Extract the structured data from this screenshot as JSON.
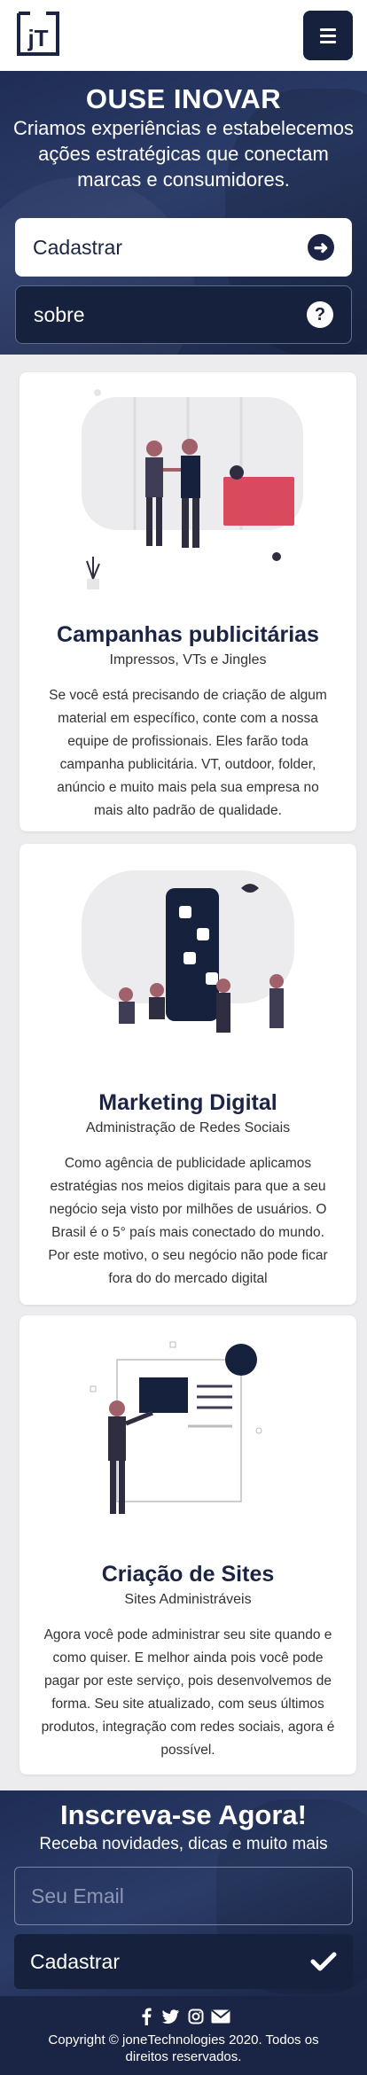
{
  "brand": {
    "logo_text": "jT"
  },
  "hero": {
    "title": "OUSE INOVAR",
    "subtitle": "Criamos experiências e estabelecemos ações estratégicas que conectam marcas e consumidores.",
    "primary_button": "Cadastrar",
    "secondary_button": "sobre"
  },
  "services": [
    {
      "title": "Campanhas publicitárias",
      "subtitle": "Impressos, VTs e Jingles",
      "text": "Se você está precisando de criação de algum material em específico, conte com a nossa equipe de profissionais. Eles farão toda campanha publicitária. VT, outdoor, folder, anúncio e muito mais pela sua empresa no mais alto padrão de qualidade."
    },
    {
      "title": "Marketing Digital",
      "subtitle": "Administração de Redes Sociais",
      "text": "Como agência de publicidade aplicamos estratégias nos meios digitais para que a seu negócio seja visto por milhões de usuários. O Brasil é o 5° país mais conectado do mundo. Por este motivo, o seu negócio não pode ficar fora do do mercado digital"
    },
    {
      "title": "Criação de Sites",
      "subtitle": "Sites Administráveis",
      "text": "Agora você pode administrar seu site quando e como quiser. E melhor ainda pois você pode pagar por este serviço, pois desenvolvemos de forma. Seu site atualizado, com seus últimos produtos, integração com redes sociais, agora é possível."
    }
  ],
  "subscribe": {
    "title": "Inscreva-se Agora!",
    "subtitle": "Receba novidades, dicas e muito mais",
    "email_placeholder": "Seu Email",
    "button": "Cadastrar"
  },
  "footer": {
    "social_icons": [
      "facebook-icon",
      "twitter-icon",
      "instagram-icon",
      "email-icon"
    ],
    "copyright": "Copyright © joneTechnologies 2020. Todos os direitos reservados."
  },
  "colors": {
    "navy": "#16213e",
    "hero": "#2c3d6a",
    "accent": "#d94a5f"
  }
}
